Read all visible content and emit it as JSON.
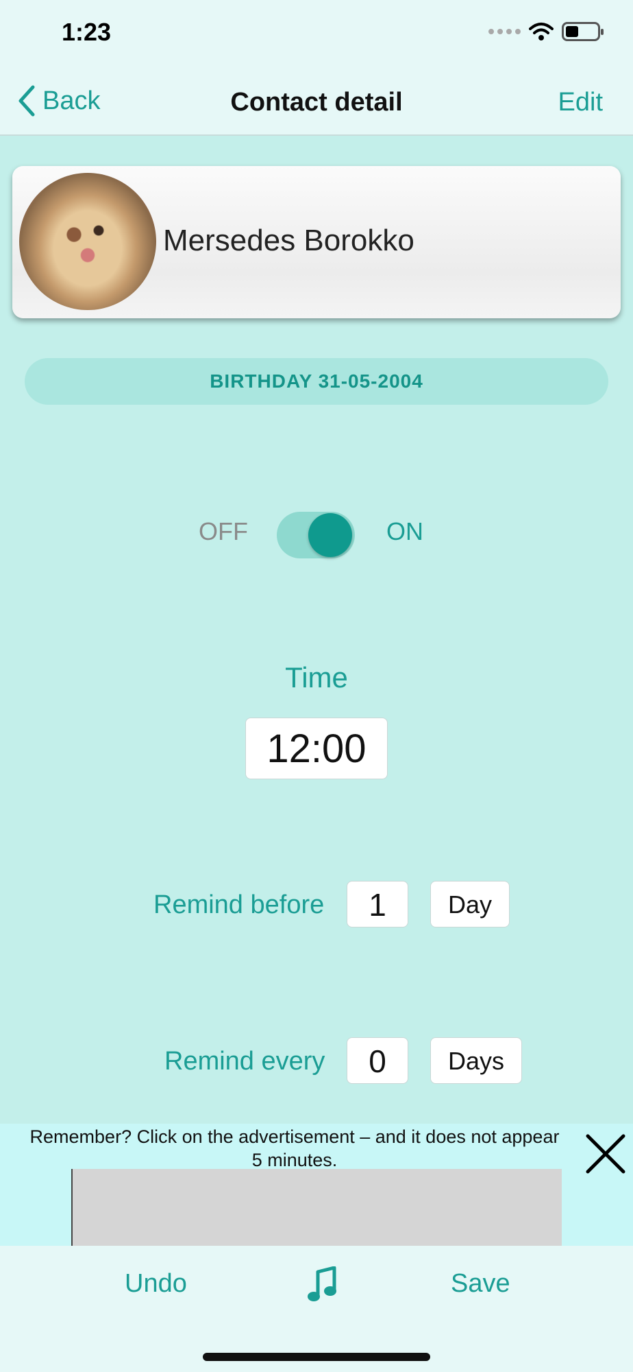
{
  "status_bar": {
    "time": "1:23"
  },
  "nav": {
    "back_label": "Back",
    "title": "Contact detail",
    "edit_label": "Edit"
  },
  "contact": {
    "name": "Mersedes Borokko",
    "avatar_icon": "dog-photo"
  },
  "birthday": {
    "text": "BIRTHDAY  31-05-2004"
  },
  "toggle": {
    "off_label": "OFF",
    "on_label": "ON",
    "state": "on"
  },
  "time": {
    "label": "Time",
    "value": "12:00"
  },
  "remind_before": {
    "label": "Remind before",
    "value": "1",
    "unit": "Day"
  },
  "remind_every": {
    "label": "Remind every",
    "value": "0",
    "unit": "Days"
  },
  "ad": {
    "text": "Remember? Click on the advertisement – and it does not appear 5 minutes."
  },
  "bottom_bar": {
    "undo_label": "Undo",
    "save_label": "Save",
    "music_icon": "music-note-icon"
  },
  "colors": {
    "accent": "#1a9d94",
    "background": "#c3efea",
    "bar": "#e6f8f7"
  }
}
